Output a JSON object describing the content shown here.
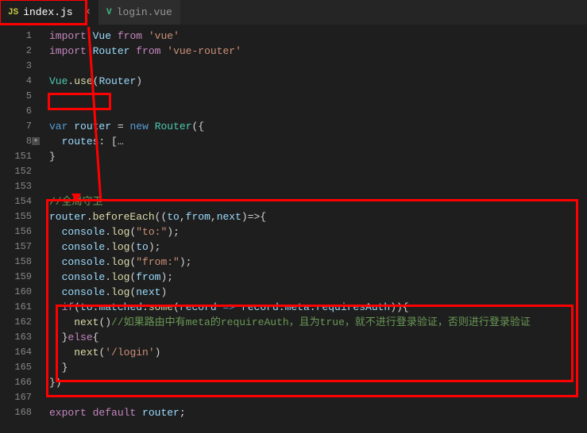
{
  "tabs": [
    {
      "icon": "JS",
      "label": "index.js",
      "active": true
    },
    {
      "icon": "V",
      "label": "login.vue",
      "active": false
    }
  ],
  "lines": [
    {
      "n": "1",
      "html": "<span class='kw2'>import</span> <span class='var'>Vue</span> <span class='kw2'>from</span> <span class='str'>'vue'</span>"
    },
    {
      "n": "2",
      "html": "<span class='kw2'>import</span> <span class='var'>Router</span> <span class='kw2'>from</span> <span class='str'>'vue-router'</span>"
    },
    {
      "n": "3",
      "html": ""
    },
    {
      "n": "4",
      "html": "<span class='cls'>Vue</span><span class='pun'>.</span><span class='fn'>use</span><span class='pun'>(</span><span class='var'>Router</span><span class='pun'>)</span>"
    },
    {
      "n": "5",
      "html": ""
    },
    {
      "n": "6",
      "html": ""
    },
    {
      "n": "7",
      "html": "<span class='kw'>var</span> <span class='var'>router</span> <span class='op'>=</span> <span class='kw'>new</span> <span class='cls'>Router</span><span class='pun'>({</span>"
    },
    {
      "n": "8",
      "html": "  <span class='var'>routes</span><span class='pun'>: [</span><span class='pun'>…</span>",
      "fold": true
    },
    {
      "n": "151",
      "html": "<span class='pun'>}</span>"
    },
    {
      "n": "152",
      "html": ""
    },
    {
      "n": "153",
      "html": ""
    },
    {
      "n": "154",
      "html": "<span class='cmt'>//全局守卫</span>"
    },
    {
      "n": "155",
      "html": "<span class='var'>router</span><span class='pun'>.</span><span class='fn'>beforeEach</span><span class='pun'>((</span><span class='var'>to</span><span class='pun'>,</span><span class='var'>from</span><span class='pun'>,</span><span class='var'>next</span><span class='pun'>)=&gt;{</span>"
    },
    {
      "n": "156",
      "html": "  <span class='var'>console</span><span class='pun'>.</span><span class='fn'>log</span><span class='pun'>(</span><span class='str'>\"to:\"</span><span class='pun'>);</span>"
    },
    {
      "n": "157",
      "html": "  <span class='var'>console</span><span class='pun'>.</span><span class='fn'>log</span><span class='pun'>(</span><span class='var'>to</span><span class='pun'>);</span>"
    },
    {
      "n": "158",
      "html": "  <span class='var'>console</span><span class='pun'>.</span><span class='fn'>log</span><span class='pun'>(</span><span class='str'>\"from:\"</span><span class='pun'>);</span>"
    },
    {
      "n": "159",
      "html": "  <span class='var'>console</span><span class='pun'>.</span><span class='fn'>log</span><span class='pun'>(</span><span class='var'>from</span><span class='pun'>);</span>"
    },
    {
      "n": "160",
      "html": "  <span class='var'>console</span><span class='pun'>.</span><span class='fn'>log</span><span class='pun'>(</span><span class='var'>next</span><span class='pun'>)</span>"
    },
    {
      "n": "161",
      "html": "  <span class='kw2'>if</span><span class='pun'>(</span><span class='var'>to</span><span class='pun'>.</span><span class='var'>matched</span><span class='pun'>.</span><span class='fn'>some</span><span class='pun'>(</span><span class='var'>record</span> <span class='kw'>=&gt;</span> <span class='var'>record</span><span class='pun'>.</span><span class='var'>meta</span><span class='pun'>.</span><span class='var'>requiresAuth</span><span class='pun'>)){</span>"
    },
    {
      "n": "162",
      "html": "    <span class='fn'>next</span><span class='pun'>()</span><span class='cmt'>//如果路由中有meta的requireAuth，且为true，就不进行登录验证，否则进行登录验证</span>"
    },
    {
      "n": "163",
      "html": "  <span class='pun'>}</span><span class='kw2'>else</span><span class='pun'>{</span>"
    },
    {
      "n": "164",
      "html": "    <span class='fn'>next</span><span class='pun'>(</span><span class='str'>'/login'</span><span class='pun'>)</span>"
    },
    {
      "n": "165",
      "html": "  <span class='pun'>}</span>"
    },
    {
      "n": "166",
      "html": "<span class='pun'>})</span>"
    },
    {
      "n": "167",
      "html": ""
    },
    {
      "n": "168",
      "html": "<span class='kw2'>export</span> <span class='kw2'>default</span> <span class='var'>router</span><span class='pun'>;</span>"
    }
  ]
}
